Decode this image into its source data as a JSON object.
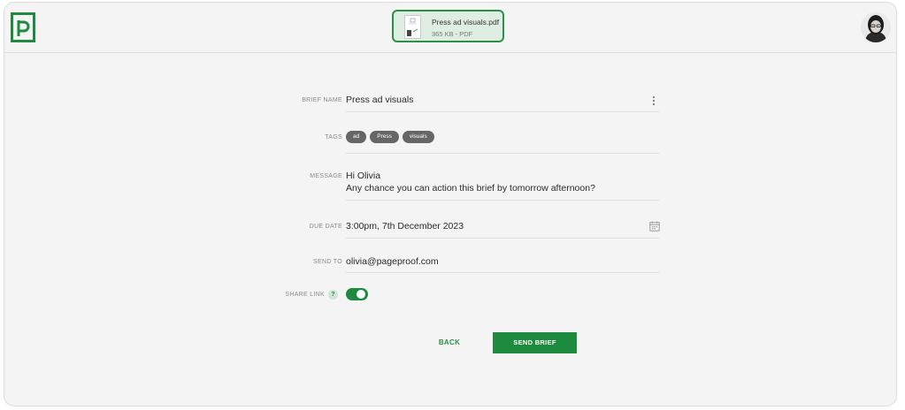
{
  "file": {
    "name": "Press ad visuals.pdf",
    "meta": "365 KB - PDF"
  },
  "form": {
    "brief_name": {
      "label": "BRIEF NAME",
      "value": "Press ad visuals",
      "menu_icon": "kebab-menu-icon"
    },
    "tags": {
      "label": "TAGS",
      "items": [
        "ad",
        "Press",
        "visuals"
      ]
    },
    "message": {
      "label": "MESSAGE",
      "line1": "Hi Olivia",
      "line2": "Any chance you can action this brief by tomorrow afternoon?"
    },
    "due_date": {
      "label": "DUE DATE",
      "value": "3:00pm, 7th December 2023",
      "icon": "calendar-icon"
    },
    "send_to": {
      "label": "SEND TO",
      "value": "olivia@pageproof.com"
    },
    "share_link": {
      "label": "SHARE LINK",
      "help": "?",
      "enabled": true
    }
  },
  "actions": {
    "back_label": "BACK",
    "send_label": "SEND BRIEF"
  },
  "colors": {
    "accent": "#1e8a3e",
    "background": "#f4f4f4",
    "tag_bg": "#666666"
  }
}
